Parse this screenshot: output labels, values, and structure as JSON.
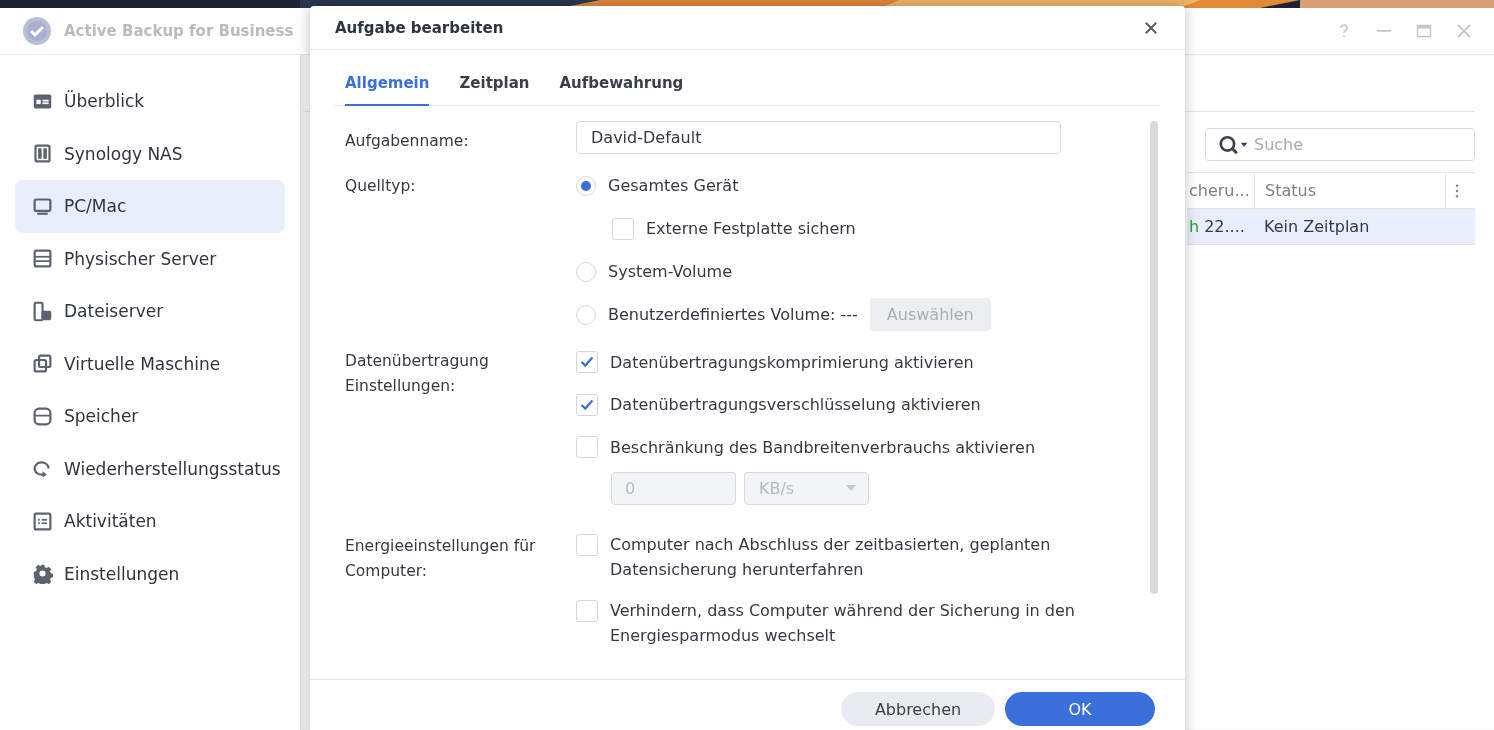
{
  "app": {
    "title": "Active Backup for Business"
  },
  "sidebar": {
    "items": [
      {
        "label": "Überblick",
        "selected": false
      },
      {
        "label": "Synology NAS",
        "selected": false
      },
      {
        "label": "PC/Mac",
        "selected": true
      },
      {
        "label": "Physischer Server",
        "selected": false
      },
      {
        "label": "Dateiserver",
        "selected": false
      },
      {
        "label": "Virtuelle Maschine",
        "selected": false
      },
      {
        "label": "Speicher",
        "selected": false
      },
      {
        "label": "Wiederherstellungsstatus",
        "selected": false
      },
      {
        "label": "Aktivitäten",
        "selected": false
      },
      {
        "label": "Einstellungen",
        "selected": false
      }
    ]
  },
  "search": {
    "placeholder": "Suche"
  },
  "table": {
    "columns": [
      "cheru...",
      "Status"
    ],
    "rows": [
      {
        "selected": true,
        "result": "h",
        "time": "22....",
        "status": "Kein Zeitplan"
      }
    ]
  },
  "dialog": {
    "title": "Aufgabe bearbeiten",
    "tabs": [
      {
        "label": "Allgemein",
        "selected": true
      },
      {
        "label": "Zeitplan",
        "selected": false
      },
      {
        "label": "Aufbewahrung",
        "selected": false
      }
    ],
    "task_name": {
      "label": "Aufgabenname:",
      "value": "David-Default"
    },
    "source_type": {
      "label": "Quelltyp:",
      "options": [
        {
          "label": "Gesamtes Gerät",
          "selected": true,
          "suboption": {
            "label": "Externe Festplatte sichern",
            "checked": false
          }
        },
        {
          "label": "System-Volume",
          "selected": false
        },
        {
          "label": "Benutzerdefiniertes Volume: ---",
          "selected": false,
          "button": {
            "label": "Auswählen",
            "disabled": true
          }
        }
      ]
    },
    "transfer": {
      "label": "Datenübertragung Einstellungen:",
      "options": [
        {
          "label": "Datenübertragungskomprimierung aktivieren",
          "checked": true
        },
        {
          "label": "Datenübertragungsverschlüsselung aktivieren",
          "checked": true
        },
        {
          "label": "Beschränkung des Bandbreitenverbrauchs aktivieren",
          "checked": false
        }
      ],
      "bandwidth": {
        "value": "0",
        "unit": "KB/s",
        "disabled": true
      }
    },
    "power": {
      "label": "Energieeinstellungen für Computer:",
      "options": [
        {
          "label": "Computer nach Abschluss der zeitbasierten, geplanten Datensicherung herunterfahren",
          "checked": false
        },
        {
          "label": "Verhindern, dass Computer während der Sicherung in den Energiesparmodus wechselt",
          "checked": false
        }
      ]
    },
    "buttons": {
      "cancel": "Abbrechen",
      "ok": "OK"
    }
  }
}
